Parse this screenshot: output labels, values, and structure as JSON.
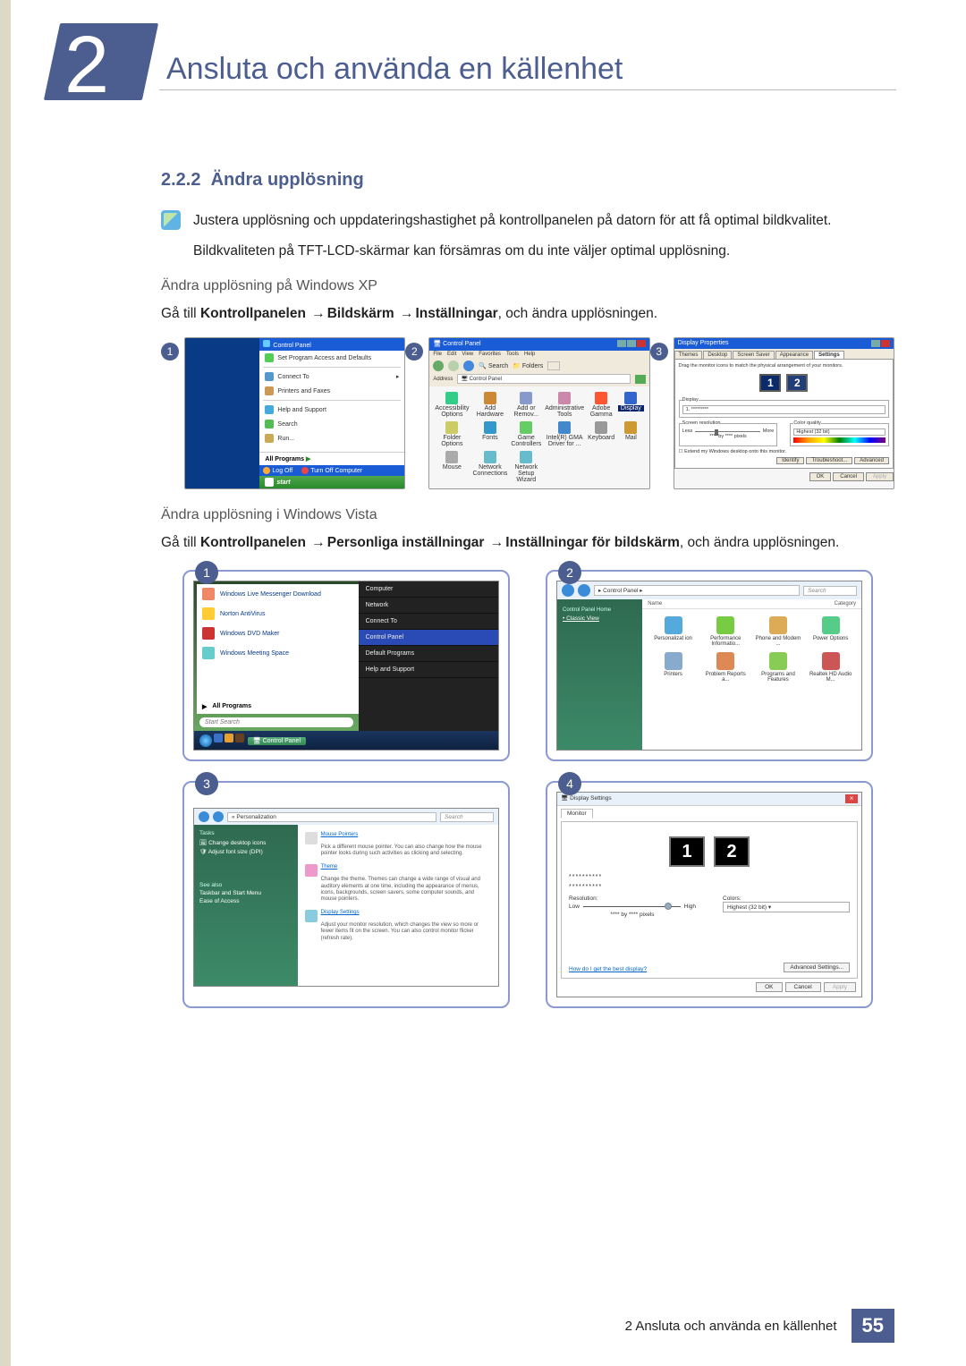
{
  "chapter": {
    "number": "2",
    "title": "Ansluta och använda en källenhet"
  },
  "section": {
    "number": "2.2.2",
    "title": "Ändra upplösning"
  },
  "info1": "Justera upplösning och uppdateringshastighet på kontrollpanelen på datorn för att få optimal bildkvalitet.",
  "para2": "Bildkvaliteten på TFT-LCD-skärmar kan försämras om du inte väljer optimal upplösning.",
  "xp": {
    "heading": "Ändra upplösning på Windows XP",
    "pre": "Gå till ",
    "path1": "Kontrollpanelen",
    "path2": "Bildskärm",
    "path3": "Inställningar",
    "post": ", och ändra upplösningen.",
    "s1": {
      "title": "Control Panel",
      "items": [
        "Set Program Access and Defaults",
        "Connect To",
        "Printers and Faxes",
        "Help and Support",
        "Search",
        "Run..."
      ],
      "allprograms": "All Programs",
      "logoff": "Log Off",
      "turnoff": "Turn Off Computer",
      "start": "start"
    },
    "s2": {
      "title": "Control Panel",
      "menu": [
        "File",
        "Edit",
        "View",
        "Favorites",
        "Tools",
        "Help"
      ],
      "search": "Search",
      "folders": "Folders",
      "address": "Control Panel",
      "icons": [
        {
          "l": "Accessibility Options",
          "c": "#3c8"
        },
        {
          "l": "Add Hardware",
          "c": "#c83"
        },
        {
          "l": "Add or Remov...",
          "c": "#89c"
        },
        {
          "l": "Administrative Tools",
          "c": "#c8a"
        },
        {
          "l": "Adobe Gamma",
          "c": "#f53"
        },
        {
          "l": "Display",
          "c": "#36c",
          "sel": true
        },
        {
          "l": "Folder Options",
          "c": "#cc6"
        },
        {
          "l": "Fonts",
          "c": "#39c"
        },
        {
          "l": "Game Controllers",
          "c": "#6c6"
        },
        {
          "l": "Intel(R) GMA Driver for ...",
          "c": "#48c"
        },
        {
          "l": "Keyboard",
          "c": "#999"
        },
        {
          "l": "Mail",
          "c": "#c93"
        },
        {
          "l": "Mouse",
          "c": "#aaa"
        },
        {
          "l": "Network Connections",
          "c": "#6bc"
        },
        {
          "l": "Network Setup Wizard",
          "c": "#6bc"
        }
      ]
    },
    "s3": {
      "title": "Display Properties",
      "tabs": [
        "Themes",
        "Desktop",
        "Screen Saver",
        "Appearance",
        "Settings"
      ],
      "hint": "Drag the monitor icons to match the physical arrangement of your monitors.",
      "display": "Display",
      "leftlegend": "Screen resolution",
      "less": "Less",
      "more": "More",
      "byres": "**** by **** pixels",
      "rightlegend": "Color quality",
      "colorq": "Highest (32 bit)",
      "chk": "Extend my Windows desktop onto this monitor.",
      "identify": "Identify",
      "troubleshoot": "Troubleshoot...",
      "advanced": "Advanced",
      "ok": "OK",
      "cancel": "Cancel",
      "apply": "Apply"
    }
  },
  "vista": {
    "heading": "Ändra upplösning i Windows Vista",
    "pre": "Gå till ",
    "path1": "Kontrollpanelen",
    "path2": "Personliga inställningar",
    "path3": "Inställningar för bildskärm",
    "post": ", och ändra upplösningen.",
    "s1": {
      "left": [
        {
          "l": "Windows Live Messenger Download",
          "c": "#e86"
        },
        {
          "l": "Norton AntiVirus",
          "c": "#fc3"
        },
        {
          "l": "Windows DVD Maker",
          "c": "#c33"
        },
        {
          "l": "Windows Meeting Space",
          "c": "#6cc"
        }
      ],
      "all": "All Programs",
      "search": "Start Search",
      "right": [
        "Computer",
        "Network",
        "Connect To",
        "Control Panel",
        "Default Programs",
        "Help and Support"
      ],
      "taskbarctrl": "Control Panel"
    },
    "s2": {
      "crumb": "▸ Control Panel ▸",
      "search": "Search",
      "home": "Control Panel Home",
      "classic": "Classic View",
      "headers": [
        "Name",
        "Category"
      ],
      "icons": [
        {
          "l": "Personalizat ion",
          "c": "#5ad"
        },
        {
          "l": "Performance Informatio...",
          "c": "#7c4"
        },
        {
          "l": "Phone and Modem ...",
          "c": "#da5"
        },
        {
          "l": "Power Options",
          "c": "#5c8"
        },
        {
          "l": "Printers",
          "c": "#8ac"
        },
        {
          "l": "Problem Reports a...",
          "c": "#d85"
        },
        {
          "l": "Programs and Features",
          "c": "#8c5"
        },
        {
          "l": "Realtek HD Audio M...",
          "c": "#c55"
        }
      ]
    },
    "s3": {
      "crumb": "« Personalization",
      "search": "Search",
      "tasks": "Tasks",
      "t1": "Change desktop icons",
      "t2": "Adjust font size (DPI)",
      "seealso": "See also",
      "sa1": "Taskbar and Start Menu",
      "sa2": "Ease of Access",
      "sec1t": "Mouse Pointers",
      "sec1d": "Pick a different mouse pointer. You can also change how the mouse pointer looks during such activities as clicking and selecting.",
      "sec2t": "Theme",
      "sec2d": "Change the theme. Themes can change a wide range of visual and auditory elements at one time, including the appearance of menus, icons, backgrounds, screen savers, some computer sounds, and mouse pointers.",
      "sec3t": "Display Settings",
      "sec3d": "Adjust your monitor resolution, which changes the view so more or fewer items fit on the screen. You can also control monitor flicker (refresh rate)."
    },
    "s4": {
      "title": "Display Settings",
      "tab": "Monitor",
      "stars1": "**********",
      "stars2": "**********",
      "res": "Resolution:",
      "low": "Low",
      "high": "High",
      "by": "**** by **** pixels",
      "colors": "Colors:",
      "colval": "Highest (32 bit)",
      "link": "How do I get the best display?",
      "adv": "Advanced Settings...",
      "ok": "OK",
      "cancel": "Cancel",
      "apply": "Apply"
    }
  },
  "footer": {
    "text": "2 Ansluta och använda en källenhet",
    "page": "55"
  }
}
